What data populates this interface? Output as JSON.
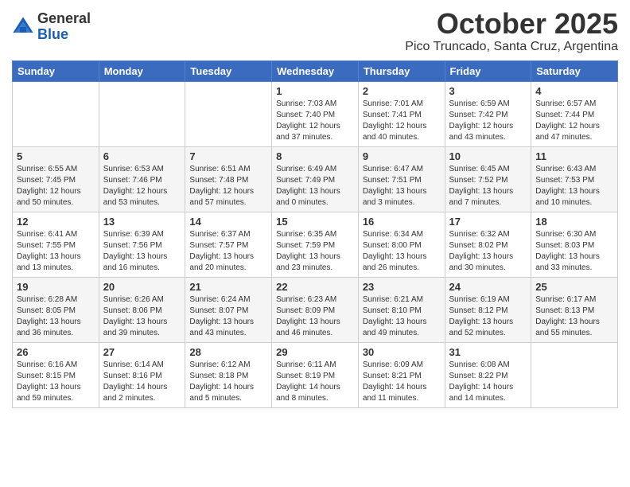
{
  "header": {
    "logo_general": "General",
    "logo_blue": "Blue",
    "month_title": "October 2025",
    "location": "Pico Truncado, Santa Cruz, Argentina"
  },
  "weekdays": [
    "Sunday",
    "Monday",
    "Tuesday",
    "Wednesday",
    "Thursday",
    "Friday",
    "Saturday"
  ],
  "weeks": [
    [
      {
        "day": "",
        "info": ""
      },
      {
        "day": "",
        "info": ""
      },
      {
        "day": "",
        "info": ""
      },
      {
        "day": "1",
        "info": "Sunrise: 7:03 AM\nSunset: 7:40 PM\nDaylight: 12 hours\nand 37 minutes."
      },
      {
        "day": "2",
        "info": "Sunrise: 7:01 AM\nSunset: 7:41 PM\nDaylight: 12 hours\nand 40 minutes."
      },
      {
        "day": "3",
        "info": "Sunrise: 6:59 AM\nSunset: 7:42 PM\nDaylight: 12 hours\nand 43 minutes."
      },
      {
        "day": "4",
        "info": "Sunrise: 6:57 AM\nSunset: 7:44 PM\nDaylight: 12 hours\nand 47 minutes."
      }
    ],
    [
      {
        "day": "5",
        "info": "Sunrise: 6:55 AM\nSunset: 7:45 PM\nDaylight: 12 hours\nand 50 minutes."
      },
      {
        "day": "6",
        "info": "Sunrise: 6:53 AM\nSunset: 7:46 PM\nDaylight: 12 hours\nand 53 minutes."
      },
      {
        "day": "7",
        "info": "Sunrise: 6:51 AM\nSunset: 7:48 PM\nDaylight: 12 hours\nand 57 minutes."
      },
      {
        "day": "8",
        "info": "Sunrise: 6:49 AM\nSunset: 7:49 PM\nDaylight: 13 hours\nand 0 minutes."
      },
      {
        "day": "9",
        "info": "Sunrise: 6:47 AM\nSunset: 7:51 PM\nDaylight: 13 hours\nand 3 minutes."
      },
      {
        "day": "10",
        "info": "Sunrise: 6:45 AM\nSunset: 7:52 PM\nDaylight: 13 hours\nand 7 minutes."
      },
      {
        "day": "11",
        "info": "Sunrise: 6:43 AM\nSunset: 7:53 PM\nDaylight: 13 hours\nand 10 minutes."
      }
    ],
    [
      {
        "day": "12",
        "info": "Sunrise: 6:41 AM\nSunset: 7:55 PM\nDaylight: 13 hours\nand 13 minutes."
      },
      {
        "day": "13",
        "info": "Sunrise: 6:39 AM\nSunset: 7:56 PM\nDaylight: 13 hours\nand 16 minutes."
      },
      {
        "day": "14",
        "info": "Sunrise: 6:37 AM\nSunset: 7:57 PM\nDaylight: 13 hours\nand 20 minutes."
      },
      {
        "day": "15",
        "info": "Sunrise: 6:35 AM\nSunset: 7:59 PM\nDaylight: 13 hours\nand 23 minutes."
      },
      {
        "day": "16",
        "info": "Sunrise: 6:34 AM\nSunset: 8:00 PM\nDaylight: 13 hours\nand 26 minutes."
      },
      {
        "day": "17",
        "info": "Sunrise: 6:32 AM\nSunset: 8:02 PM\nDaylight: 13 hours\nand 30 minutes."
      },
      {
        "day": "18",
        "info": "Sunrise: 6:30 AM\nSunset: 8:03 PM\nDaylight: 13 hours\nand 33 minutes."
      }
    ],
    [
      {
        "day": "19",
        "info": "Sunrise: 6:28 AM\nSunset: 8:05 PM\nDaylight: 13 hours\nand 36 minutes."
      },
      {
        "day": "20",
        "info": "Sunrise: 6:26 AM\nSunset: 8:06 PM\nDaylight: 13 hours\nand 39 minutes."
      },
      {
        "day": "21",
        "info": "Sunrise: 6:24 AM\nSunset: 8:07 PM\nDaylight: 13 hours\nand 43 minutes."
      },
      {
        "day": "22",
        "info": "Sunrise: 6:23 AM\nSunset: 8:09 PM\nDaylight: 13 hours\nand 46 minutes."
      },
      {
        "day": "23",
        "info": "Sunrise: 6:21 AM\nSunset: 8:10 PM\nDaylight: 13 hours\nand 49 minutes."
      },
      {
        "day": "24",
        "info": "Sunrise: 6:19 AM\nSunset: 8:12 PM\nDaylight: 13 hours\nand 52 minutes."
      },
      {
        "day": "25",
        "info": "Sunrise: 6:17 AM\nSunset: 8:13 PM\nDaylight: 13 hours\nand 55 minutes."
      }
    ],
    [
      {
        "day": "26",
        "info": "Sunrise: 6:16 AM\nSunset: 8:15 PM\nDaylight: 13 hours\nand 59 minutes."
      },
      {
        "day": "27",
        "info": "Sunrise: 6:14 AM\nSunset: 8:16 PM\nDaylight: 14 hours\nand 2 minutes."
      },
      {
        "day": "28",
        "info": "Sunrise: 6:12 AM\nSunset: 8:18 PM\nDaylight: 14 hours\nand 5 minutes."
      },
      {
        "day": "29",
        "info": "Sunrise: 6:11 AM\nSunset: 8:19 PM\nDaylight: 14 hours\nand 8 minutes."
      },
      {
        "day": "30",
        "info": "Sunrise: 6:09 AM\nSunset: 8:21 PM\nDaylight: 14 hours\nand 11 minutes."
      },
      {
        "day": "31",
        "info": "Sunrise: 6:08 AM\nSunset: 8:22 PM\nDaylight: 14 hours\nand 14 minutes."
      },
      {
        "day": "",
        "info": ""
      }
    ]
  ]
}
